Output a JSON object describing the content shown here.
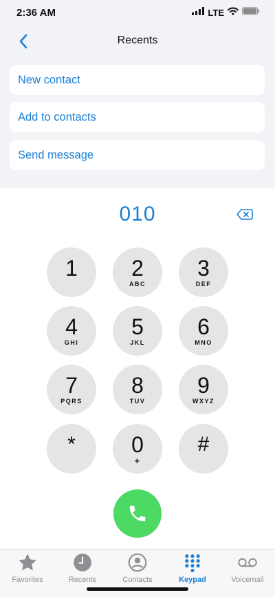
{
  "status_bar": {
    "time": "2:36 AM",
    "carrier": "LTE",
    "icons": [
      "signal-icon",
      "wifi-icon",
      "battery-icon"
    ]
  },
  "nav": {
    "back_icon": "chevron-left-icon",
    "title": "Recents"
  },
  "actions": [
    {
      "label": "New contact"
    },
    {
      "label": "Add to contacts"
    },
    {
      "label": "Send message"
    }
  ],
  "dialer": {
    "number": "010",
    "delete_icon": "delete-backspace-icon"
  },
  "keypad": [
    {
      "digit": "1",
      "letters": ""
    },
    {
      "digit": "2",
      "letters": "ABC"
    },
    {
      "digit": "3",
      "letters": "DEF"
    },
    {
      "digit": "4",
      "letters": "GHI"
    },
    {
      "digit": "5",
      "letters": "JKL"
    },
    {
      "digit": "6",
      "letters": "MNO"
    },
    {
      "digit": "7",
      "letters": "PQRS"
    },
    {
      "digit": "8",
      "letters": "TUV"
    },
    {
      "digit": "9",
      "letters": "WXYZ"
    },
    {
      "digit": "*",
      "letters": ""
    },
    {
      "digit": "0",
      "letters": "+"
    },
    {
      "digit": "#",
      "letters": ""
    }
  ],
  "call": {
    "icon": "phone-icon"
  },
  "tabs": [
    {
      "label": "Favorites",
      "icon": "star-icon",
      "active": false
    },
    {
      "label": "Recents",
      "icon": "clock-icon",
      "active": false
    },
    {
      "label": "Contacts",
      "icon": "person-circle-icon",
      "active": false
    },
    {
      "label": "Keypad",
      "icon": "keypad-grid-icon",
      "active": true
    },
    {
      "label": "Voicemail",
      "icon": "voicemail-icon",
      "active": false
    }
  ],
  "colors": {
    "accent": "#1a7fd6",
    "call_green": "#4cd964",
    "key_bg": "#e5e5e7",
    "top_bg": "#f2f3f7",
    "inactive_tab": "#8e8e93"
  }
}
